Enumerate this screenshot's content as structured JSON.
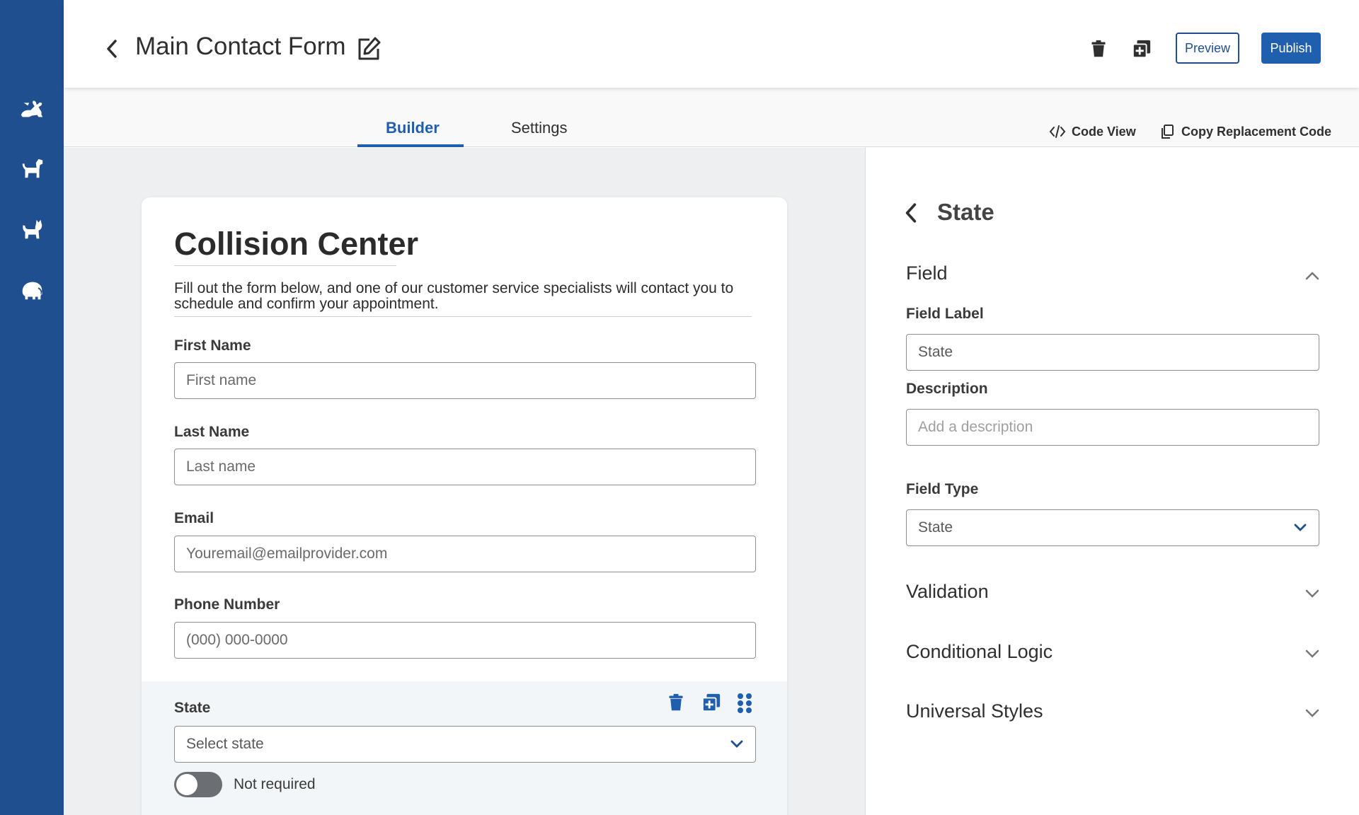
{
  "header": {
    "title": "Main Contact Form",
    "preview_label": "Preview",
    "publish_label": "Publish"
  },
  "tabs": [
    {
      "label": "Builder",
      "active": true
    },
    {
      "label": "Settings",
      "active": false
    }
  ],
  "toolbar": {
    "code_view": "Code View",
    "copy_code": "Copy Replacement Code"
  },
  "sidebar": {
    "icons": [
      "rabbit-icon",
      "dog-icon",
      "cat-icon",
      "elephant-icon"
    ]
  },
  "form": {
    "title": "Collision Center",
    "description": "Fill out the form below, and one of our customer service specialists will contact you to schedule and confirm your appointment.",
    "fields": [
      {
        "label": "First Name",
        "placeholder": "First name"
      },
      {
        "label": "Last Name",
        "placeholder": "Last name"
      },
      {
        "label": "Email",
        "placeholder": "Youremail@emailprovider.com"
      },
      {
        "label": "Phone Number",
        "placeholder": "(000) 000-0000"
      }
    ],
    "state_field": {
      "label": "State",
      "placeholder": "Select state",
      "required_label": "Not required"
    }
  },
  "panel": {
    "title": "State",
    "field_section": "Field",
    "field_label_label": "Field Label",
    "field_label_value": "State",
    "description_label": "Description",
    "description_placeholder": "Add a description",
    "field_type_label": "Field Type",
    "field_type_value": "State",
    "validation": "Validation",
    "conditional_logic": "Conditional Logic",
    "universal_styles": "Universal Styles"
  },
  "colors": {
    "brand": "#1f4f8f",
    "accent": "#1f5fae",
    "canvas_bg": "#eeeff0"
  }
}
